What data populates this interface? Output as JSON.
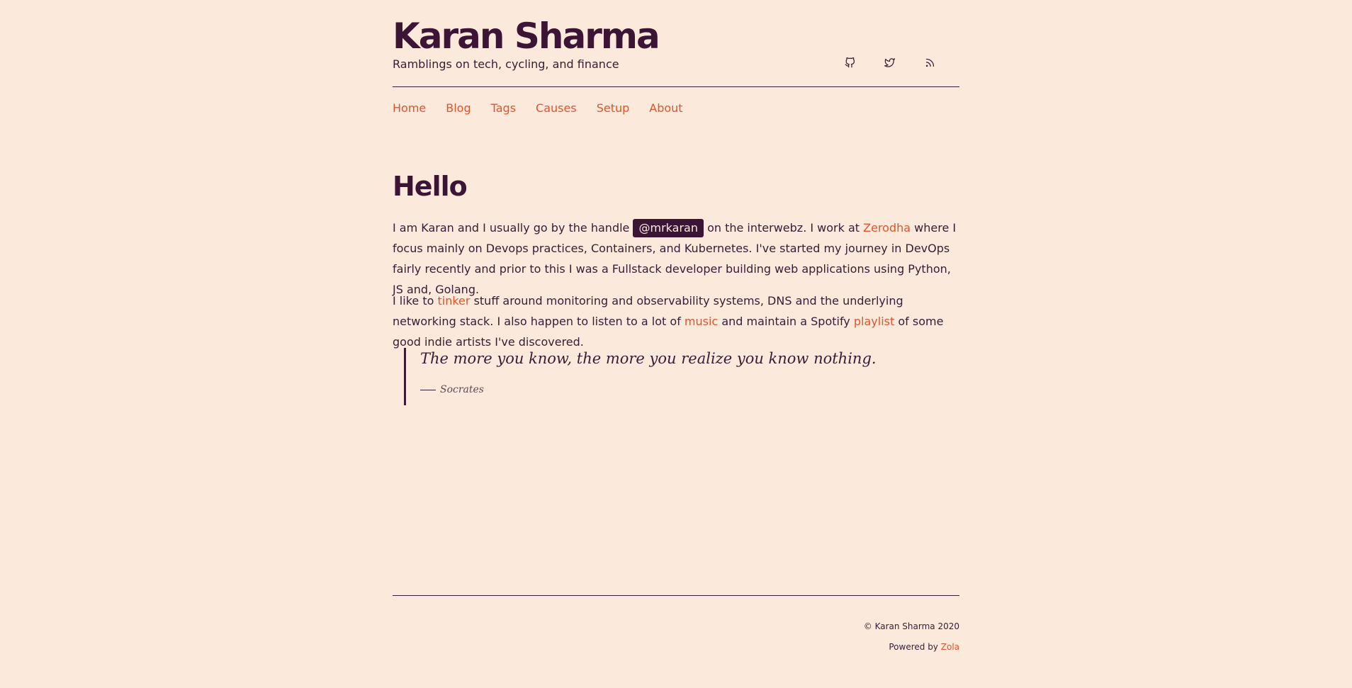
{
  "header": {
    "title": "Karan Sharma",
    "tagline": "Ramblings on tech, cycling, and finance",
    "social": [
      {
        "icon": "github-icon"
      },
      {
        "icon": "twitter-icon"
      },
      {
        "icon": "rss-icon"
      }
    ]
  },
  "nav": {
    "items": [
      "Home",
      "Blog",
      "Tags",
      "Causes",
      "Setup",
      "About"
    ]
  },
  "main": {
    "heading": "Hello",
    "intro": {
      "t1": "I am Karan and I usually go by the handle",
      "handle": "@mrkaran",
      "t2": "on the interwebz. I work at",
      "link_zerodha": "Zerodha",
      "t3": "where I focus mainly on Devops practices, Containers, and Kubernetes. I've started my journey in DevOps fairly recently and prior to this I was a Fullstack developer building web applications using Python, JS and, Golang."
    },
    "interests": {
      "t1": "I like to",
      "link_tinker": "tinker",
      "t2": "stuff around monitoring and observability systems, DNS and the underlying networking stack. I also happen to listen to a lot of",
      "link_music": "music",
      "t3": "and maintain a Spotify",
      "link_playlist": "playlist",
      "t4": "of some good indie artists I've discovered."
    },
    "quote": {
      "text": "The more you know, the more you realize you know nothing.",
      "author": "Socrates"
    }
  },
  "footer": {
    "copyright": "© Karan Sharma 2020",
    "powered_prefix": "Powered by",
    "powered_link": "Zola"
  },
  "colors": {
    "background": "#fbeadb",
    "text": "#3a1a35",
    "accent": "#e0532a"
  }
}
